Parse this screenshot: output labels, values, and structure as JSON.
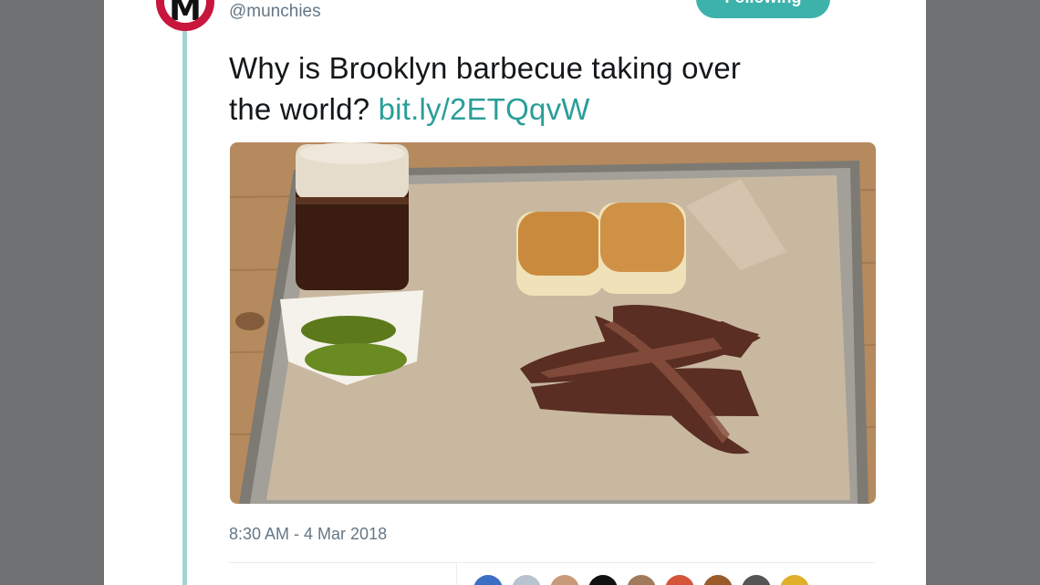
{
  "tweet": {
    "handle": "@munchies",
    "avatar_letter": "M",
    "follow_label": "Following",
    "text_line1": "Why is Brooklyn barbecue taking over",
    "text_line2": "the world? ",
    "link": "bit.ly/2ETQqvW",
    "timestamp": "8:30 AM - 4 Mar 2018",
    "image_alt": "Tray with brisket, pickles, rolls and a mason jar drink",
    "stats_text": ""
  },
  "colors": {
    "brand_red": "#c8163d",
    "accent_teal": "#3cb2ab",
    "link_teal": "#2a9e98",
    "thread_line": "#9fd6d4"
  },
  "likers": [
    {
      "color": "#3a6fc4"
    },
    {
      "color": "#b7c3cf"
    },
    {
      "color": "#c79a7a"
    },
    {
      "color": "#111111"
    },
    {
      "color": "#a07a5a"
    },
    {
      "color": "#d4553a"
    },
    {
      "color": "#9a5a2a"
    },
    {
      "color": "#555555"
    },
    {
      "color": "#e0b02a"
    }
  ]
}
